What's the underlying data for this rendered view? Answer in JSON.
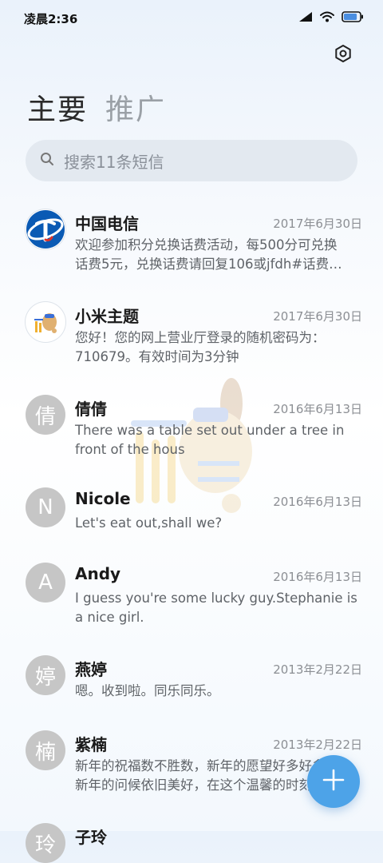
{
  "status_bar": {
    "time": "凌晨2:36",
    "battery_level": 0.85
  },
  "tabs": [
    {
      "label": "主要",
      "active": true
    },
    {
      "label": "推广",
      "active": false
    }
  ],
  "search": {
    "placeholder": "搜索11条短信"
  },
  "colors": {
    "fab": "#4da3e8",
    "telecom_blue": "#0a5ab4",
    "avatar_gray": "#c6c6c6"
  },
  "messages": [
    {
      "name": "中国电信",
      "date": "2017年6月30日",
      "preview_lines": [
        "欢迎参加积分兑换话费活动，每500分可兑换",
        "话费5元，兑换话费请回复106或jfdh#话费…"
      ],
      "avatar": "china-telecom-logo"
    },
    {
      "name": "小米主题",
      "date": "2017年6月30日",
      "preview_lines": [
        "您好！您的网上营业厅登录的随机密码为：",
        "710679。有效时间为3分钟"
      ],
      "avatar": "mi-theme-logo"
    },
    {
      "name": "倩倩",
      "date": "2016年6月13日",
      "preview_lines": [
        "There was a table set out under a tree in",
        "front of the hous"
      ],
      "avatar": "倩"
    },
    {
      "name": "Nicole",
      "date": "2016年6月13日",
      "preview_lines": [
        "Let's eat out,shall we?"
      ],
      "avatar": "N"
    },
    {
      "name": "Andy",
      "date": "2016年6月13日",
      "preview_lines": [
        "I guess you're some lucky guy.Stephanie is",
        "a nice girl."
      ],
      "avatar": "A"
    },
    {
      "name": "燕婷",
      "date": "2013年2月22日",
      "preview_lines": [
        "嗯。收到啦。同乐同乐。"
      ],
      "avatar": "婷"
    },
    {
      "name": "紫楠",
      "date": "2013年2月22日",
      "preview_lines": [
        "新年的祝福数不胜数，新年的愿望好多好多，",
        "新年的问候依旧美好，在这个温馨的时刻…"
      ],
      "avatar": "楠"
    },
    {
      "name": "子玲",
      "date": "",
      "preview_lines": [],
      "avatar": "玲"
    }
  ]
}
